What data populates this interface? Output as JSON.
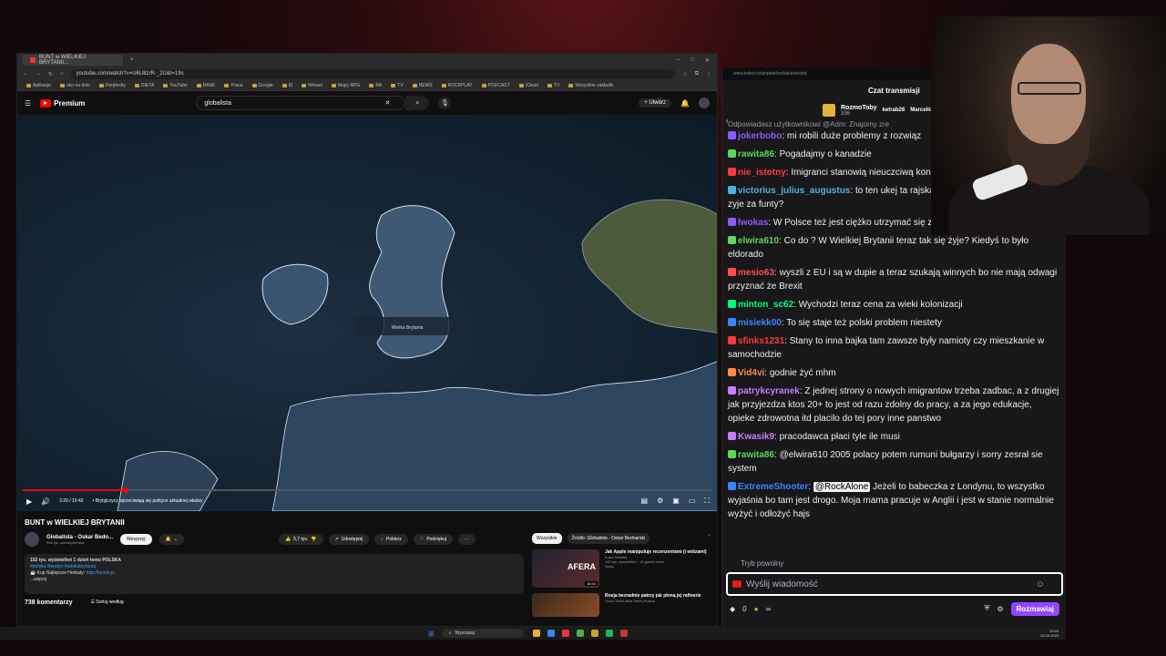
{
  "browser": {
    "tab_title": "BUNT w WIELKIEJ BRYTANII...",
    "url": "youtube.com/watch?v=U6U8zrR-_2U&t=19s",
    "bookmarks": [
      "Aplikacje",
      "oko na dole",
      "Perplexity",
      "DIETA",
      "YouTube",
      "BANK",
      "Praca",
      "Google",
      "El",
      "Wrload",
      "Mapy RPG",
      "RA",
      "TV",
      "NEWS",
      "ROCKPLAY",
      "PODCAST",
      "iCloud",
      "TV",
      "Wszystkie zakładki"
    ]
  },
  "youtube": {
    "logo": "Premium",
    "search_value": "globalista",
    "create_label": "Utwórz",
    "player": {
      "time": "2:20 / 15:42",
      "chapter": "• Brytyjczycy sprzeciwiają się polityce aktualnej władzy",
      "progress": 0.149,
      "map_label": "Wielka Brytania"
    },
    "video_title": "BUNT w WIELKIEJ BRYTANII",
    "channel_name": "Globalista - Oskar Bedn...",
    "subscribers": "906 tys. subskrybentów",
    "support_label": "Wesprzyj",
    "likes": "5,7 tys.",
    "share_label": "Udostępnij",
    "download_label": "Pobierz",
    "thanks_label": "Podziękuj",
    "description": {
      "stats": "152 tys. wyświetleń  1 dzień temu  POLSKA",
      "tags": "#polska #londyn #wielkabrytania",
      "promo": "☕ Kup Najlepsze Herbaty:",
      "promo_link": "http://tuncio.pl",
      "more": "...więcej"
    },
    "comments_count": "738 komentarzy",
    "sort_label": "Sortuj według",
    "chips": [
      "Wszystkie",
      "Źródło: Globalista - Oskar Bednarski"
    ],
    "recommendations": [
      {
        "title": "Jak Apple manipuluje recenzentami (i widzami)",
        "channel": "Kuba Klawiter",
        "meta": "190 tys. wyświetleń · 14 godzin temu",
        "badge": "Nowy",
        "duration": "18:54",
        "thumb_label": "AFERA"
      },
      {
        "title": "Rosja bezradnie patrzy jak płoną jej rafinerie",
        "channel": "Good Times Bad Times Polska",
        "meta": "",
        "badge": "",
        "duration": "",
        "thumb_label": ""
      }
    ]
  },
  "taskbar": {
    "search_placeholder": "Wyszukaj",
    "time": "10:59",
    "date": "23.09.2025"
  },
  "chat": {
    "url": "www.twitch.tv/popout/rockalone/chat",
    "header": "Czat transmisji",
    "gift_user": "RozmoToby",
    "gift_count": "336",
    "gift_user2": "ketrab28",
    "gift_user3": "Marcellos",
    "reply_preview": "Odpowiadasz użytkownikowi @Adm: Znajomy zre",
    "messages": [
      {
        "user": "jokerbobo",
        "color": "#8a5cf6",
        "text": "mi robili duże problemy z rozwiąz"
      },
      {
        "user": "rawita86",
        "color": "#5cd65c",
        "text": "Pogadajmy o kanadzie"
      },
      {
        "user": "nie_istotny",
        "color": "#ff3b3b",
        "text": "Imigranci stanowią nieuczciwą kon można im mniej płacić"
      },
      {
        "user": "victorius_julius_augustus",
        "color": "#4fb3d9",
        "text": "to ten ukej ta rajska emigruja bo tam to sie dopiero zyje za funty?"
      },
      {
        "user": "lwokas",
        "color": "#8a5cf6",
        "text": "W Polsce też jest ciężko utrzymać się z jednego etatu"
      },
      {
        "user": "elwira610",
        "color": "#5cd65c",
        "text": "Co do ? W Wielkiej Brytanii teraz tak się żyje? Kiedyś to było eldorado"
      },
      {
        "user": "mesio63",
        "color": "#ff4f4f",
        "text": "wyszli z EU i są w dupie a teraz szukają winnych bo nie mają odwagi przyznać że Brexit"
      },
      {
        "user": "minton_sc62",
        "color": "#00ff7f",
        "text": "Wychodzi teraz cena za wieki kolonizacji"
      },
      {
        "user": "misiekk00",
        "color": "#3a86ff",
        "text": "To się staje też polski problem niestety"
      },
      {
        "user": "sfinks1231",
        "color": "#ff3b3b",
        "text": "Stany to inna bajka tam zawsze były namioty czy mieszkanie w samochodzie"
      },
      {
        "user": "Vid4vi",
        "color": "#ff8c42",
        "text": "godnie żyć mhm"
      },
      {
        "user": "patrykcyranek",
        "color": "#c77dff",
        "text": "Z jednej strony o nowych imigrantow trzeba zadbac, a z drugiej jak przyjezdza ktos 20+ to jest od razu zdolny do pracy, a za jego edukacje, opieke zdrowotna itd placilo do tej pory inne panstwo"
      },
      {
        "user": "Kwasik9",
        "color": "#c77dff",
        "text": "pracodawca płaci tyle ile musi"
      },
      {
        "user": "rawita86",
        "color": "#5cd65c",
        "text": "@elwira610 2005 polacy potem rumuni bułgarzy i sorry zesrał sie system"
      },
      {
        "user": "ExtremeShooter",
        "color": "#3a86ff",
        "mention": "@RockAlone",
        "text": "Jeżeli to babeczka z Londynu, to wszystko wyjaśnia bo tam jest drogo. Moja mama pracuje w Anglii i jest w stanie normalnie wyżyć i odłożyć hajs"
      }
    ],
    "slow_mode": "Tryb powolny",
    "input_placeholder": "Wyślij wiadomość",
    "points": "0",
    "points_extra": "∞",
    "send_label": "Rozmawiaj"
  }
}
